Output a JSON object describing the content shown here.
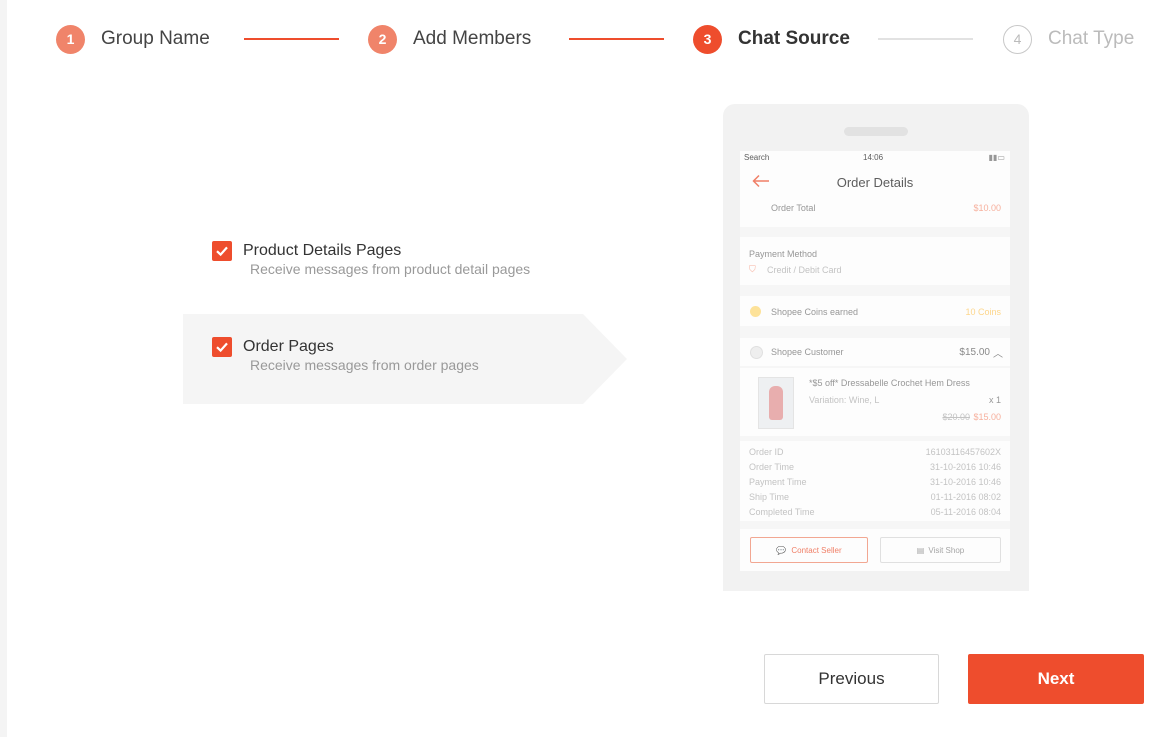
{
  "stepper": {
    "steps": [
      {
        "number": "1",
        "label": "Group Name",
        "state": "completed"
      },
      {
        "number": "2",
        "label": "Add Members",
        "state": "completed"
      },
      {
        "number": "3",
        "label": "Chat Source",
        "state": "active"
      },
      {
        "number": "4",
        "label": "Chat Type",
        "state": "pending"
      }
    ]
  },
  "sources": [
    {
      "title": "Product Details Pages",
      "description": "Receive messages from product detail pages",
      "checked": true
    },
    {
      "title": "Order Pages",
      "description": "Receive messages from order pages",
      "checked": true,
      "selected": true
    }
  ],
  "preview": {
    "status_bar": {
      "carrier": "Search",
      "time": "14:06"
    },
    "title": "Order Details",
    "order_total_label": "Order Total",
    "order_total_value": "$10.00",
    "payment_method_label": "Payment Method",
    "payment_method_value": "Credit / Debit Card",
    "coins_label": "Shopee Coins earned",
    "coins_value": "10 Coins",
    "shop_name": "Shopee Customer",
    "shop_total": "$15.00",
    "product": {
      "name": "*$5 off* Dressabelle Crochet Hem Dress",
      "variation": "Variation: Wine, L",
      "quantity": "x 1",
      "original_price": "$20.00",
      "price": "$15.00"
    },
    "details": [
      {
        "label": "Order ID",
        "value": "16103116457602X"
      },
      {
        "label": "Order Time",
        "value": "31-10-2016 10:46"
      },
      {
        "label": "Payment Time",
        "value": "31-10-2016 10:46"
      },
      {
        "label": "Ship Time",
        "value": "01-11-2016 08:02"
      },
      {
        "label": "Completed Time",
        "value": "05-11-2016 08:04"
      }
    ],
    "contact_label": "Contact Seller",
    "visit_label": "Visit Shop"
  },
  "actions": {
    "previous": "Previous",
    "next": "Next"
  },
  "colors": {
    "accent": "#ee4d2d",
    "accent_light": "#f0846a",
    "inactive": "#c8c8c8"
  }
}
